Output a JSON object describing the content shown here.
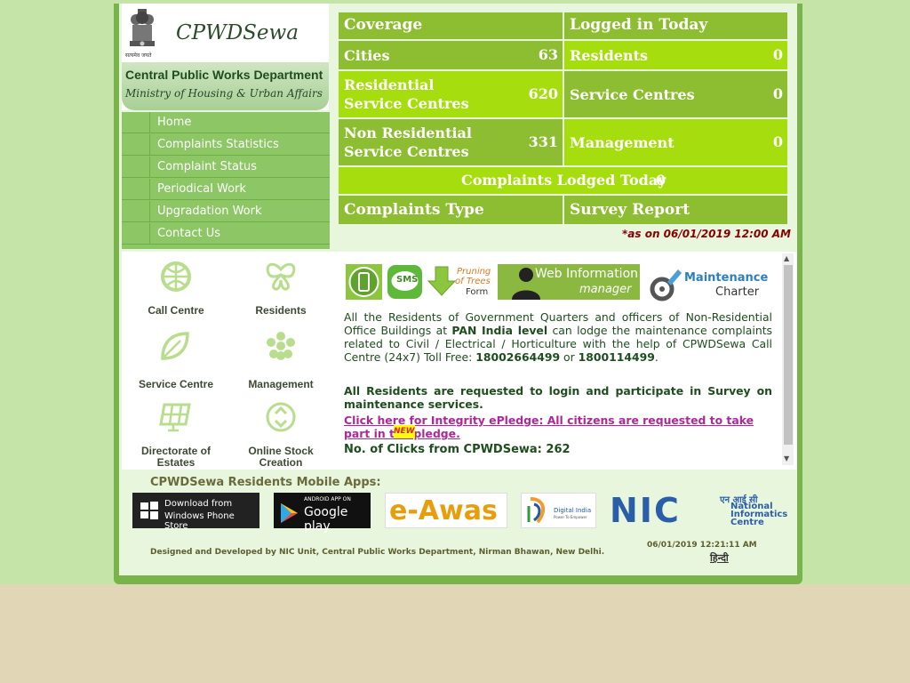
{
  "header": {
    "brand": "CPWDSewa",
    "department": "Central Public Works Department",
    "ministry": "Ministry of Housing & Urban Affairs",
    "emblem_motto": "सत्यमेव जयते"
  },
  "nav": {
    "items": [
      {
        "label": "Home"
      },
      {
        "label": "Complaints Statistics"
      },
      {
        "label": "Complaint Status"
      },
      {
        "label": "Periodical Work"
      },
      {
        "label": "Upgradation Work"
      },
      {
        "label": "Contact Us"
      }
    ]
  },
  "tiles": [
    {
      "label": "Call Centre",
      "icon": "globe-icon"
    },
    {
      "label": "Residents",
      "icon": "butterfly-icon"
    },
    {
      "label": "Service Centre",
      "icon": "leaf-icon"
    },
    {
      "label": "Management",
      "icon": "flower-icon"
    },
    {
      "label": "Directorate of Estates",
      "icon": "solar-panel-icon"
    },
    {
      "label": "Online Stock Creation",
      "icon": "recycle-icon"
    }
  ],
  "stats": {
    "coverage_header": "Coverage",
    "logged_header": "Logged in Today",
    "cities_label": "Cities",
    "cities_value": "63",
    "residents_label": "Residents",
    "residents_value": "0",
    "residential_label_1": "Residential",
    "residential_label_2": "Service Centres",
    "residential_value": "620",
    "service_centres_label": "Service Centres",
    "service_centres_value": "0",
    "nonres_label_1": "Non Residential",
    "nonres_label_2": "Service Centres",
    "nonres_value": "331",
    "management_label": "Management",
    "management_value": "0",
    "complaints_today_label": "Complaints Lodged Today",
    "complaints_today_value": "0",
    "complaints_type": "Complaints Type",
    "survey_report": "Survey Report",
    "as_on": "*as on 06/01/2019 12:00 AM"
  },
  "banners": {
    "sms": "SMS",
    "pruning_1": "Pruning",
    "pruning_2": "of Trees",
    "pruning_3": "Form",
    "web_info_1": "Web Information",
    "web_info_2": "manager",
    "maintenance_1": "Maintenance",
    "maintenance_2": "Charter"
  },
  "content": {
    "p1_a": "All the Residents of Government Quarters and officers of Non-Residential Office Buildings at ",
    "p1_b": "PAN India level",
    "p1_c": " can lodge the maintenance complaints related to Civil / Electrical / Horticulture with the help of CPWDSewa Call Centre (24x7) Toll Free: ",
    "p1_d": "18002664499",
    "p1_e": " or ",
    "p1_f": "1800114499",
    "p1_g": ".",
    "p2": "All Residents are requested to login and participate in Survey on maintenance services.",
    "pledge": "Click here for Integrity ePledge: All citizens are requested to take part in the pledge.",
    "new_badge": "NEW",
    "clicks": "No. of Clicks from CPWDSewa: 262"
  },
  "footer": {
    "apps_title": "CPWDSewa Residents Mobile Apps:",
    "windows_1": "Download from",
    "windows_2": "Windows Phone Store",
    "google_1": "ANDROID APP ON",
    "google_2": "Google play",
    "eawas": "e-Awas",
    "digital_india": "Digital India",
    "digital_india_tag": "Power To Empower",
    "nic_hindi": "एन आई सी",
    "nic_1": "National",
    "nic_2": "Informatics",
    "nic_3": "Centre",
    "nic_short": "NIC",
    "designed": "Designed and Developed by NIC Unit, Central Public Works Department, Nirman Bhawan, New Delhi.",
    "timestamp": "06/01/2019 12:21:11 AM",
    "hindi_link": "हिन्दी"
  },
  "colors": {
    "stat_dark": "#8dbe32",
    "stat_bright": "#a6dd0f",
    "menu_green": "#8cc665",
    "frame_green": "#79b44b"
  }
}
